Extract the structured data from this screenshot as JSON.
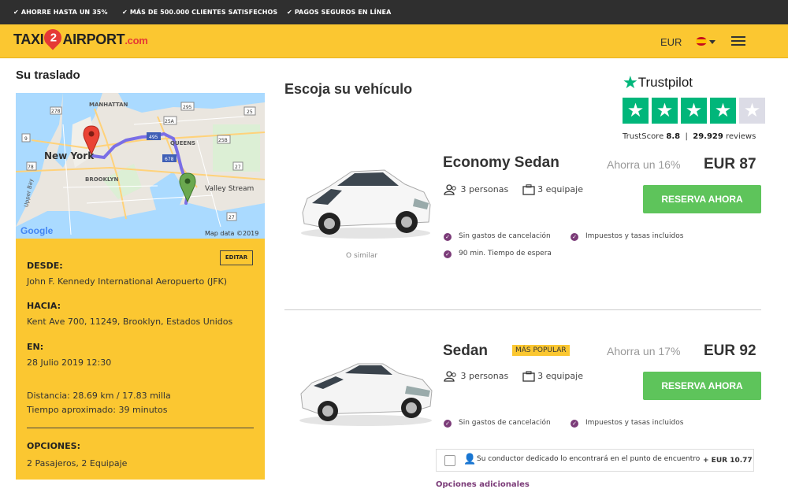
{
  "topbar": {
    "items": [
      "AHORRE HASTA UN 35%",
      "MÁS DE 500.000 CLIENTES SATISFECHOS",
      "PAGOS SEGUROS EN LÍNEA"
    ]
  },
  "header": {
    "logo_pre": "TAXI",
    "logo_num": "2",
    "logo_post": "AIRPORT",
    "logo_domain": ".com",
    "currency": "EUR"
  },
  "sidebar": {
    "title": "Su traslado",
    "map": {
      "labels": [
        "MANHATTAN",
        "New York",
        "BROOKLYN",
        "QUEENS",
        "Valley Stream",
        "Upper Bay",
        "Google",
        "Map data ©2019"
      ],
      "shields": [
        "9",
        "278",
        "295",
        "495",
        "25A",
        "678",
        "25B",
        "25",
        "27",
        "78",
        "27"
      ]
    },
    "edit_label": "EDITAR",
    "from_label": "DESDE:",
    "from_value": "John F. Kennedy International Aeropuerto (JFK)",
    "to_label": "HACIA:",
    "to_value": "Kent Ave 700, 11249, Brooklyn, Estados Unidos",
    "on_label": "EN:",
    "on_value": "28 Julio 2019 12:30",
    "distance": "Distancia: 28.69 km / 17.83 milla",
    "time": "Tiempo aproximado: 39 minutos",
    "options_label": "OPCIONES:",
    "options_value": "2 Pasajeros,  2  Equipaje"
  },
  "main": {
    "title": "Escoja su vehículo"
  },
  "trustpilot": {
    "name": "Trustpilot",
    "score_label": "TrustScore",
    "score": "8.8",
    "separator": "|",
    "reviews": "29.929",
    "reviews_label": "reviews",
    "stars_filled": 4,
    "stars_total": 5
  },
  "cars": [
    {
      "name": "Economy Sedan",
      "badge": "",
      "save": "Ahorra un 16%",
      "price": "EUR 87",
      "persons": "3  personas",
      "luggage": "3  equipaje",
      "button": "RESERVA AHORA",
      "similar": "O similar",
      "features": [
        "Sin gastos de cancelación",
        "Impuestos y tasas incluidos",
        "90 min. Tiempo de espera"
      ]
    },
    {
      "name": "Sedan",
      "badge": "MÁS POPULAR",
      "save": "Ahorra un 17%",
      "price": "EUR 92",
      "persons": "3  personas",
      "luggage": "3  equipaje",
      "button": "RESERVA AHORA",
      "features": [
        "Sin gastos de cancelación",
        "Impuestos y tasas incluidos"
      ]
    }
  ],
  "extra": {
    "text": "Su conductor dedicado lo encontrará en el punto de encuentro",
    "price": "+ EUR 10.77"
  },
  "additional_options": "Opciones adicionales",
  "colors": {
    "brand_yellow": "#fbc731",
    "dark_bar": "#2f2f2f",
    "cta_green": "#5ec45b",
    "trust_green": "#00b67a",
    "feature_purple": "#7b3b78",
    "pin_red": "#e53935"
  }
}
